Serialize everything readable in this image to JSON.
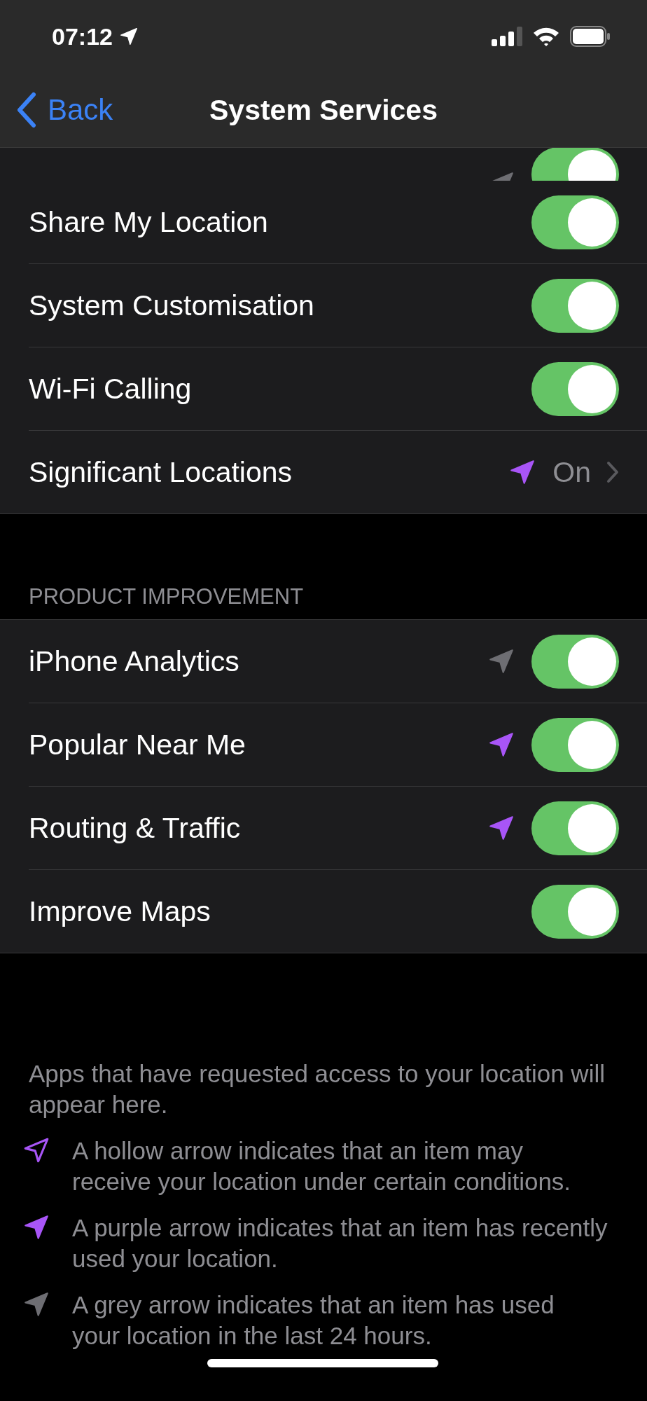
{
  "status_bar": {
    "time": "07:12"
  },
  "nav": {
    "back": "Back",
    "title": "System Services"
  },
  "clipped_row": {
    "on": true,
    "location_arrow": {
      "color": "#6e6e73"
    }
  },
  "groups": [
    {
      "rows": [
        {
          "kind": "toggle",
          "label": "Share My Location",
          "on": true
        },
        {
          "kind": "toggle",
          "label": "System Customisation",
          "on": true
        },
        {
          "kind": "toggle",
          "label": "Wi-Fi Calling",
          "on": true
        },
        {
          "kind": "link",
          "label": "Significant Locations",
          "value": "On",
          "location_arrow": {
            "color": "#a855f7"
          }
        }
      ]
    },
    {
      "header": "PRODUCT IMPROVEMENT",
      "rows": [
        {
          "kind": "toggle",
          "label": "iPhone Analytics",
          "on": true,
          "location_arrow": {
            "color": "#6e6e73"
          }
        },
        {
          "kind": "toggle",
          "label": "Popular Near Me",
          "on": true,
          "location_arrow": {
            "color": "#a855f7"
          }
        },
        {
          "kind": "toggle",
          "label": "Routing & Traffic",
          "on": true,
          "location_arrow": {
            "color": "#a855f7"
          }
        },
        {
          "kind": "toggle",
          "label": "Improve Maps",
          "on": true
        }
      ]
    }
  ],
  "footer": {
    "intro": "Apps that have requested access to your location will appear here.",
    "legend": [
      {
        "kind": "hollow",
        "color": "#a855f7",
        "text": "A hollow arrow indicates that an item may receive your location under certain conditions."
      },
      {
        "kind": "filled",
        "color": "#a855f7",
        "text": "A purple arrow indicates that an item has recently used your location."
      },
      {
        "kind": "filled",
        "color": "#6e6e73",
        "text": "A grey arrow indicates that an item has used your location in the last 24 hours."
      }
    ]
  }
}
